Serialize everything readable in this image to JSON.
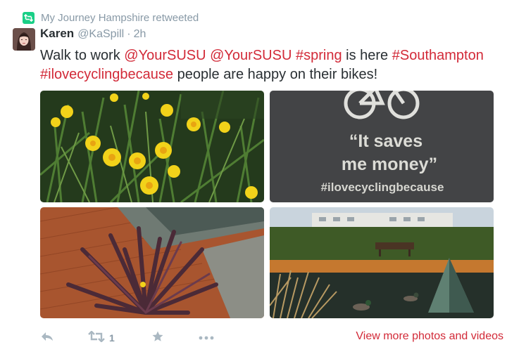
{
  "retweet_context": {
    "text": "My Journey Hampshire retweeted",
    "icon": "retweet-icon",
    "accent": "#19cf86"
  },
  "tweet": {
    "author_name": "Karen",
    "author_handle": "@KaSpill",
    "separator": "·",
    "timestamp": "2h",
    "text_parts": [
      {
        "text": "Walk to work ",
        "link": false
      },
      {
        "text": "@YourSUSU",
        "link": true
      },
      {
        "text": " ",
        "link": false
      },
      {
        "text": "@YourSUSU",
        "link": true
      },
      {
        "text": " ",
        "link": false
      },
      {
        "text": "#spring",
        "link": true
      },
      {
        "text": " is here ",
        "link": false
      },
      {
        "text": "#Southampton",
        "link": true
      },
      {
        "text": " ",
        "link": false
      },
      {
        "text": "#ilovecyclingbecause",
        "link": true
      },
      {
        "text": " people are happy on their bikes!",
        "link": false
      }
    ],
    "link_color": "#d22a38"
  },
  "photos": [
    {
      "name": "photo-daffodils"
    },
    {
      "name": "photo-cycling-stencil",
      "stencil_line1": "“It saves",
      "stencil_line2": "me money”",
      "stencil_hashtag": "#ilovecyclingbecause"
    },
    {
      "name": "photo-red-plant"
    },
    {
      "name": "photo-pond-ducks"
    }
  ],
  "actions": {
    "reply_icon": "reply-icon",
    "retweet_icon": "retweet-icon",
    "retweet_count": "1",
    "favorite_icon": "star-icon",
    "more_icon": "more-icon",
    "icon_color": "#aab8c2"
  },
  "view_more": "View more photos and videos"
}
